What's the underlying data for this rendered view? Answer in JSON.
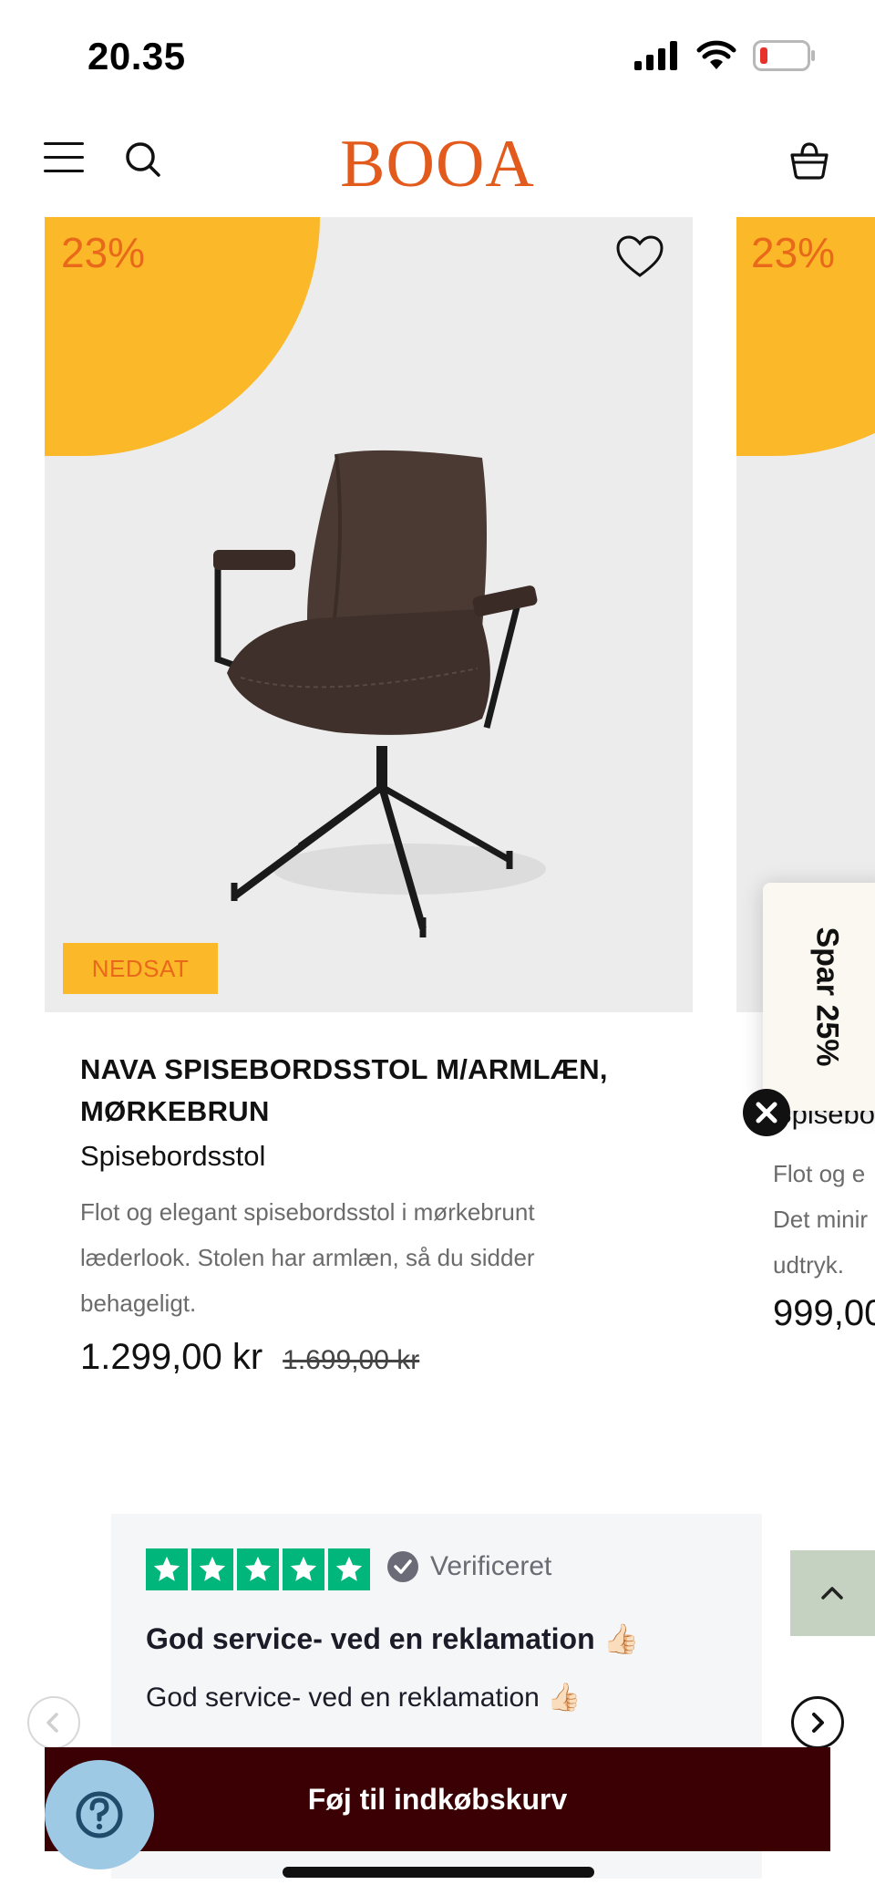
{
  "status_bar": {
    "time": "20.35"
  },
  "header": {
    "logo": "BOOA"
  },
  "products": [
    {
      "discount": "23%",
      "badge": "NEDSAT",
      "title": "NAVA SPISEBORDSSTOL M/ARMLÆN, MØRKEBRUN",
      "category": "Spisebordsstol",
      "description": "Flot og elegant spisebordsstol i mørkebrunt læderlook. Stolen har armlæn, så du sidder behageligt.",
      "price": "1.299,00 kr",
      "old_price": "1.699,00 kr"
    },
    {
      "discount": "23%",
      "title_partial": "Spisebo",
      "description_lines": [
        "Flot og e",
        "Det minir",
        "udtryk."
      ],
      "price_partial": "999,00"
    }
  ],
  "promo": {
    "label": "Spar 25%"
  },
  "review": {
    "verified": "Verificeret",
    "title": "God service- ved en reklamation 👍🏻",
    "text": "God service- ved en reklamation 👍🏻"
  },
  "cta": {
    "label": "Føj til indkøbskurv"
  },
  "colors": {
    "brand": "#e25a1c",
    "badge": "#fbb828",
    "cta": "#3a0004",
    "trustpilot": "#00b67a"
  }
}
